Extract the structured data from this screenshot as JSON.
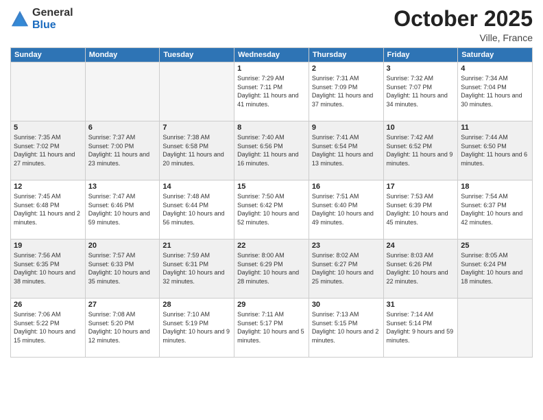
{
  "logo": {
    "general": "General",
    "blue": "Blue"
  },
  "header": {
    "month": "October 2025",
    "location": "Ville, France"
  },
  "days_of_week": [
    "Sunday",
    "Monday",
    "Tuesday",
    "Wednesday",
    "Thursday",
    "Friday",
    "Saturday"
  ],
  "weeks": [
    {
      "shaded": false,
      "days": [
        {
          "empty": true
        },
        {
          "empty": true
        },
        {
          "empty": true
        },
        {
          "num": "1",
          "sunrise": "Sunrise: 7:29 AM",
          "sunset": "Sunset: 7:11 PM",
          "daylight": "Daylight: 11 hours and 41 minutes."
        },
        {
          "num": "2",
          "sunrise": "Sunrise: 7:31 AM",
          "sunset": "Sunset: 7:09 PM",
          "daylight": "Daylight: 11 hours and 37 minutes."
        },
        {
          "num": "3",
          "sunrise": "Sunrise: 7:32 AM",
          "sunset": "Sunset: 7:07 PM",
          "daylight": "Daylight: 11 hours and 34 minutes."
        },
        {
          "num": "4",
          "sunrise": "Sunrise: 7:34 AM",
          "sunset": "Sunset: 7:04 PM",
          "daylight": "Daylight: 11 hours and 30 minutes."
        }
      ]
    },
    {
      "shaded": true,
      "days": [
        {
          "num": "5",
          "sunrise": "Sunrise: 7:35 AM",
          "sunset": "Sunset: 7:02 PM",
          "daylight": "Daylight: 11 hours and 27 minutes."
        },
        {
          "num": "6",
          "sunrise": "Sunrise: 7:37 AM",
          "sunset": "Sunset: 7:00 PM",
          "daylight": "Daylight: 11 hours and 23 minutes."
        },
        {
          "num": "7",
          "sunrise": "Sunrise: 7:38 AM",
          "sunset": "Sunset: 6:58 PM",
          "daylight": "Daylight: 11 hours and 20 minutes."
        },
        {
          "num": "8",
          "sunrise": "Sunrise: 7:40 AM",
          "sunset": "Sunset: 6:56 PM",
          "daylight": "Daylight: 11 hours and 16 minutes."
        },
        {
          "num": "9",
          "sunrise": "Sunrise: 7:41 AM",
          "sunset": "Sunset: 6:54 PM",
          "daylight": "Daylight: 11 hours and 13 minutes."
        },
        {
          "num": "10",
          "sunrise": "Sunrise: 7:42 AM",
          "sunset": "Sunset: 6:52 PM",
          "daylight": "Daylight: 11 hours and 9 minutes."
        },
        {
          "num": "11",
          "sunrise": "Sunrise: 7:44 AM",
          "sunset": "Sunset: 6:50 PM",
          "daylight": "Daylight: 11 hours and 6 minutes."
        }
      ]
    },
    {
      "shaded": false,
      "days": [
        {
          "num": "12",
          "sunrise": "Sunrise: 7:45 AM",
          "sunset": "Sunset: 6:48 PM",
          "daylight": "Daylight: 11 hours and 2 minutes."
        },
        {
          "num": "13",
          "sunrise": "Sunrise: 7:47 AM",
          "sunset": "Sunset: 6:46 PM",
          "daylight": "Daylight: 10 hours and 59 minutes."
        },
        {
          "num": "14",
          "sunrise": "Sunrise: 7:48 AM",
          "sunset": "Sunset: 6:44 PM",
          "daylight": "Daylight: 10 hours and 56 minutes."
        },
        {
          "num": "15",
          "sunrise": "Sunrise: 7:50 AM",
          "sunset": "Sunset: 6:42 PM",
          "daylight": "Daylight: 10 hours and 52 minutes."
        },
        {
          "num": "16",
          "sunrise": "Sunrise: 7:51 AM",
          "sunset": "Sunset: 6:40 PM",
          "daylight": "Daylight: 10 hours and 49 minutes."
        },
        {
          "num": "17",
          "sunrise": "Sunrise: 7:53 AM",
          "sunset": "Sunset: 6:39 PM",
          "daylight": "Daylight: 10 hours and 45 minutes."
        },
        {
          "num": "18",
          "sunrise": "Sunrise: 7:54 AM",
          "sunset": "Sunset: 6:37 PM",
          "daylight": "Daylight: 10 hours and 42 minutes."
        }
      ]
    },
    {
      "shaded": true,
      "days": [
        {
          "num": "19",
          "sunrise": "Sunrise: 7:56 AM",
          "sunset": "Sunset: 6:35 PM",
          "daylight": "Daylight: 10 hours and 38 minutes."
        },
        {
          "num": "20",
          "sunrise": "Sunrise: 7:57 AM",
          "sunset": "Sunset: 6:33 PM",
          "daylight": "Daylight: 10 hours and 35 minutes."
        },
        {
          "num": "21",
          "sunrise": "Sunrise: 7:59 AM",
          "sunset": "Sunset: 6:31 PM",
          "daylight": "Daylight: 10 hours and 32 minutes."
        },
        {
          "num": "22",
          "sunrise": "Sunrise: 8:00 AM",
          "sunset": "Sunset: 6:29 PM",
          "daylight": "Daylight: 10 hours and 28 minutes."
        },
        {
          "num": "23",
          "sunrise": "Sunrise: 8:02 AM",
          "sunset": "Sunset: 6:27 PM",
          "daylight": "Daylight: 10 hours and 25 minutes."
        },
        {
          "num": "24",
          "sunrise": "Sunrise: 8:03 AM",
          "sunset": "Sunset: 6:26 PM",
          "daylight": "Daylight: 10 hours and 22 minutes."
        },
        {
          "num": "25",
          "sunrise": "Sunrise: 8:05 AM",
          "sunset": "Sunset: 6:24 PM",
          "daylight": "Daylight: 10 hours and 18 minutes."
        }
      ]
    },
    {
      "shaded": false,
      "days": [
        {
          "num": "26",
          "sunrise": "Sunrise: 7:06 AM",
          "sunset": "Sunset: 5:22 PM",
          "daylight": "Daylight: 10 hours and 15 minutes."
        },
        {
          "num": "27",
          "sunrise": "Sunrise: 7:08 AM",
          "sunset": "Sunset: 5:20 PM",
          "daylight": "Daylight: 10 hours and 12 minutes."
        },
        {
          "num": "28",
          "sunrise": "Sunrise: 7:10 AM",
          "sunset": "Sunset: 5:19 PM",
          "daylight": "Daylight: 10 hours and 9 minutes."
        },
        {
          "num": "29",
          "sunrise": "Sunrise: 7:11 AM",
          "sunset": "Sunset: 5:17 PM",
          "daylight": "Daylight: 10 hours and 5 minutes."
        },
        {
          "num": "30",
          "sunrise": "Sunrise: 7:13 AM",
          "sunset": "Sunset: 5:15 PM",
          "daylight": "Daylight: 10 hours and 2 minutes."
        },
        {
          "num": "31",
          "sunrise": "Sunrise: 7:14 AM",
          "sunset": "Sunset: 5:14 PM",
          "daylight": "Daylight: 9 hours and 59 minutes."
        },
        {
          "empty": true
        }
      ]
    }
  ]
}
